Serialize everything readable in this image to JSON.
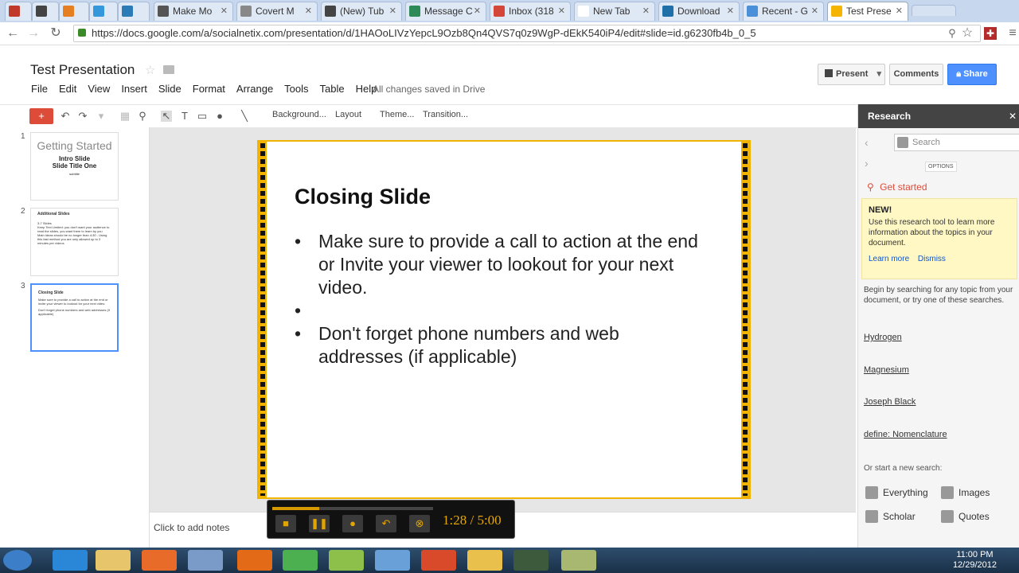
{
  "browser": {
    "tabs": [
      {
        "label": "",
        "color": "#c0392b"
      },
      {
        "label": "",
        "color": "#444444"
      },
      {
        "label": "",
        "color": "#e67e22"
      },
      {
        "label": "",
        "color": "#3498db"
      },
      {
        "label": "",
        "color": "#2c7bb6"
      },
      {
        "label": "Make Mo",
        "color": "#555555"
      },
      {
        "label": "Covert M",
        "color": "#888888"
      },
      {
        "label": "(New) Tub",
        "color": "#444444"
      },
      {
        "label": "Message C",
        "color": "#2e8b57"
      },
      {
        "label": "Inbox (318",
        "color": "#d44638"
      },
      {
        "label": "New Tab",
        "color": "#ffffff"
      },
      {
        "label": "Download",
        "color": "#1f6fa8"
      },
      {
        "label": "Recent - G",
        "color": "#4a90d9"
      },
      {
        "label": "Test Prese",
        "color": "#f4b400"
      }
    ],
    "url": "https://docs.google.com/a/socialnetix.com/presentation/d/1HAOoLIVzYepcL9Ozb8Qn4QVS7q0z9WgP-dEkK540iP4/edit#slide=id.g6230fb4b_0_5"
  },
  "doc": {
    "title": "Test Presentation",
    "menu": [
      "File",
      "Edit",
      "View",
      "Insert",
      "Slide",
      "Format",
      "Arrange",
      "Tools",
      "Table",
      "Help"
    ],
    "saved_status": "All changes saved in Drive",
    "present_label": "Present",
    "comments_label": "Comments",
    "share_label": "Share"
  },
  "toolbar": {
    "background_label": "Background...",
    "layout_label": "Layout",
    "theme_label": "Theme...",
    "transition_label": "Transition..."
  },
  "thumbnails": [
    {
      "num": "1",
      "title": "Getting Started",
      "sub1": "Intro Slide",
      "sub2": "Slide Title One",
      "tiny": "subtitle"
    },
    {
      "num": "2",
      "title": "Additional Slides",
      "lines": [
        "3-7 Slides",
        "Keep Text Limited: you don't want your audience to read the slides, you want them to learn by you",
        "Main Ideas should be no longer than 4:30 - Using this fast method you are only allowed up to 3 minutes per videos"
      ]
    },
    {
      "num": "3",
      "title": "Closing Slide",
      "lines": [
        "Make sure to provide a call to action at the end or invite your viewer to lookout for your next video.",
        "Don't forget phone numbers and web addresses (if applicable)"
      ]
    }
  ],
  "slide": {
    "title": "Closing Slide",
    "bullets": [
      "Make sure to provide a call to action at the end or Invite your viewer to lookout for your next video.",
      "",
      "Don't forget phone numbers and web addresses (if applicable)"
    ],
    "border_color": "#f0b400"
  },
  "notes": {
    "placeholder": "Click to add notes"
  },
  "recorder": {
    "time": "1:28 / 5:00",
    "progress": 0.29
  },
  "research": {
    "title": "Research",
    "search_placeholder": "Search",
    "options_label": "OPTIONS",
    "get_started": "Get started",
    "new_label": "NEW!",
    "new_text": "Use this research tool to learn more information about the topics in your document.",
    "learn_more": "Learn more",
    "dismiss": "Dismiss",
    "begin_text": "Begin by searching for any topic from your document, or try one of these searches.",
    "suggestions": [
      "Hydrogen",
      "Magnesium",
      "Joseph Black",
      "define: Nomenclature"
    ],
    "start_new": "Or start a new search:",
    "everything": "Everything",
    "images": "Images",
    "scholar": "Scholar",
    "quotes": "Quotes"
  },
  "taskbar": {
    "time": "11:00 PM",
    "date": "12/29/2012"
  }
}
